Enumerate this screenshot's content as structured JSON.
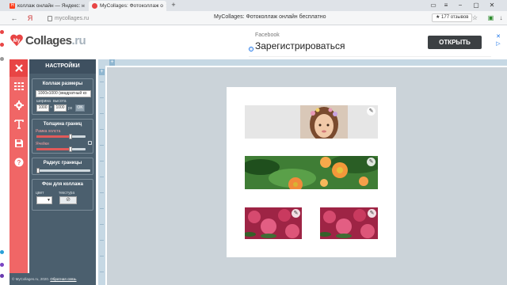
{
  "browser": {
    "tabs": [
      {
        "title": "коллаж онлайн — Яндекс: н"
      },
      {
        "title": "MyCollages: Фотоколлаж о"
      }
    ],
    "address": "mycollages.ru",
    "page_title": "MyCollages: Фотоколлаж онлайн бесплатно",
    "rating": "★ 177 отзывов"
  },
  "header": {
    "logo_prefix": "My",
    "logo_main": "Collages",
    "logo_domain": ".ru"
  },
  "ad": {
    "source": "Facebook",
    "headline": "Зарегистрироваться",
    "cta": "ОТКРЫТЬ",
    "info_glyph": "i",
    "close_glyph": "✕"
  },
  "panel": {
    "title": "НАСТРОЙКИ",
    "size_section": {
      "heading": "Коллаж размеры",
      "selected": "1000x1000 (квадратный ко",
      "width_label": "ширина",
      "height_label": "высота",
      "width": "1000",
      "height": "1000",
      "px": "px",
      "ok": "OK"
    },
    "border_section": {
      "heading": "Толщина границ",
      "outer_label": "Рамка холста",
      "inner_label": "Ячейки",
      "outer_level": 0.7,
      "inner_level": 0.7
    },
    "radius_section": {
      "heading": "Радиус границы",
      "level": 0.0
    },
    "bg_section": {
      "heading": "Фон для коллажа",
      "color_label": "цвет",
      "texture_label": "текстура",
      "color": "#ffffff",
      "texture_glyph": "⊘"
    },
    "footer_text": "© MyCollages.ru, 2020. ",
    "footer_link": "Обратная связь"
  },
  "canvas": {
    "edit_glyph": "✎",
    "ruler_plus": "+"
  },
  "colors": {
    "rail": "#f06666",
    "panel": "#4b5f6e",
    "canvas_bg": "#cbd3d9",
    "ad_button": "#3c4043"
  },
  "icons": [
    "close-icon",
    "layout-grid-icon",
    "gear-icon",
    "text-icon",
    "save-icon",
    "help-icon",
    "edit-pencil-icon"
  ]
}
